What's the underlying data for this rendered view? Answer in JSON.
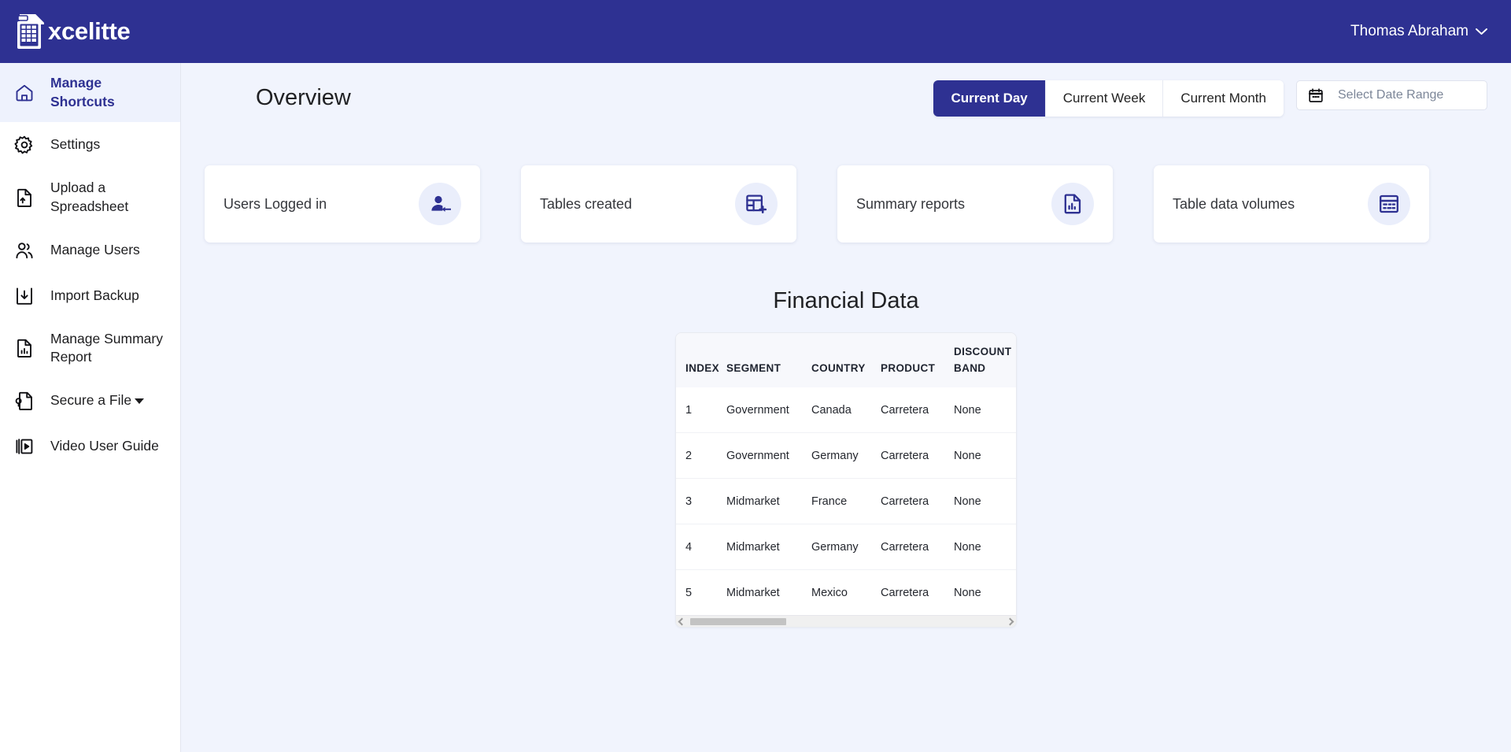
{
  "brand": {
    "name": "xcelitte",
    "logo_icon": "spreadsheet-logo-icon"
  },
  "header": {
    "user_name": "Thomas Abraham",
    "chevron_icon": "chevron-down-icon",
    "bar_color": "#2e3192"
  },
  "sidebar": {
    "items": [
      {
        "label": "Manage Shortcuts",
        "icon": "home-icon",
        "active": true
      },
      {
        "label": "Settings",
        "icon": "gear-icon",
        "active": false
      },
      {
        "label": "Upload a Spreadsheet",
        "icon": "file-upload-icon",
        "active": false
      },
      {
        "label": "Manage Users",
        "icon": "users-icon",
        "active": false
      },
      {
        "label": "Import Backup",
        "icon": "download-box-icon",
        "active": false
      },
      {
        "label": "Manage Summary Report",
        "icon": "file-chart-icon",
        "active": false
      },
      {
        "label": "Secure a File",
        "icon": "file-lock-icon",
        "active": false,
        "has_caret": true
      },
      {
        "label": "Video User Guide",
        "icon": "video-play-icon",
        "active": false
      }
    ]
  },
  "main": {
    "page_title": "Overview",
    "range_tabs": [
      {
        "label": "Current Day",
        "active": true
      },
      {
        "label": "Current Week",
        "active": false
      },
      {
        "label": "Current Month",
        "active": false
      }
    ],
    "date_range": {
      "placeholder": "Select Date Range",
      "value": "",
      "icon": "calendar-icon"
    },
    "stat_cards": [
      {
        "label": "Users Logged in",
        "icon": "user-add-icon"
      },
      {
        "label": "Tables created",
        "icon": "table-add-icon"
      },
      {
        "label": "Summary reports",
        "icon": "file-bar-chart-icon"
      },
      {
        "label": "Table data volumes",
        "icon": "table-data-icon"
      }
    ],
    "table": {
      "title": "Financial Data",
      "columns": [
        "INDEX",
        "SEGMENT",
        "COUNTRY",
        "PRODUCT",
        "DISCOUNT BAND"
      ],
      "rows": [
        [
          "1",
          "Government",
          "Canada",
          "Carretera",
          "None"
        ],
        [
          "2",
          "Government",
          "Germany",
          "Carretera",
          "None"
        ],
        [
          "3",
          "Midmarket",
          "France",
          "Carretera",
          "None"
        ],
        [
          "4",
          "Midmarket",
          "Germany",
          "Carretera",
          "None"
        ],
        [
          "5",
          "Midmarket",
          "Mexico",
          "Carretera",
          "None"
        ]
      ]
    }
  },
  "colors": {
    "brand_primary": "#2e3192",
    "page_background": "#f1f4fd",
    "card_background": "#ffffff",
    "icon_badge_background": "#eaeefb",
    "active_nav_background": "#eef2fd"
  }
}
